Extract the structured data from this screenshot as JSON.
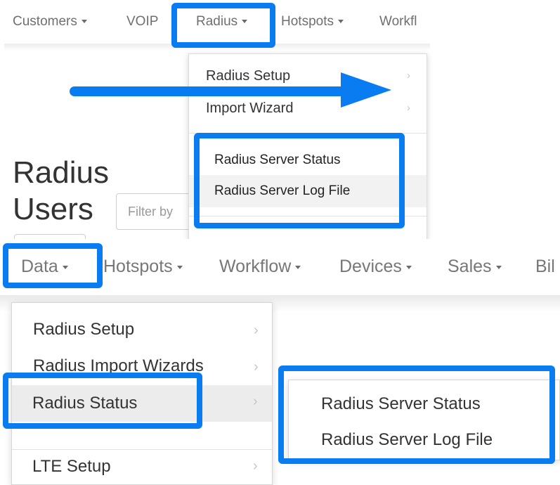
{
  "top": {
    "nav": [
      {
        "label": "Customers"
      },
      {
        "label": "VOIP"
      },
      {
        "label": "Radius"
      },
      {
        "label": "Hotspots"
      },
      {
        "label": "Workfl"
      }
    ],
    "title_line1": "Radius",
    "title_line2": "Users",
    "filter_placeholder": "Filter by",
    "menu_items": [
      "Radius Setup",
      "Import Wizard"
    ],
    "status_items": [
      "Radius Server Status",
      "Radius Server Log File"
    ]
  },
  "bottom": {
    "nav": [
      {
        "label": "Data"
      },
      {
        "label": "Hotspots"
      },
      {
        "label": "Workflow"
      },
      {
        "label": "Devices"
      },
      {
        "label": "Sales"
      },
      {
        "label": "Bil"
      }
    ],
    "menu_items": [
      "Radius Setup",
      "Radius Import Wizards",
      "Radius Status",
      "LTE Setup"
    ],
    "submenu_items": [
      "Radius Server Status",
      "Radius Server Log File"
    ]
  },
  "colors": {
    "highlight": "#0a7cf2",
    "arrow": "#0a7cf2"
  },
  "icons": {
    "caret": "caret-down-icon",
    "submenu": "chevron-right-icon"
  }
}
